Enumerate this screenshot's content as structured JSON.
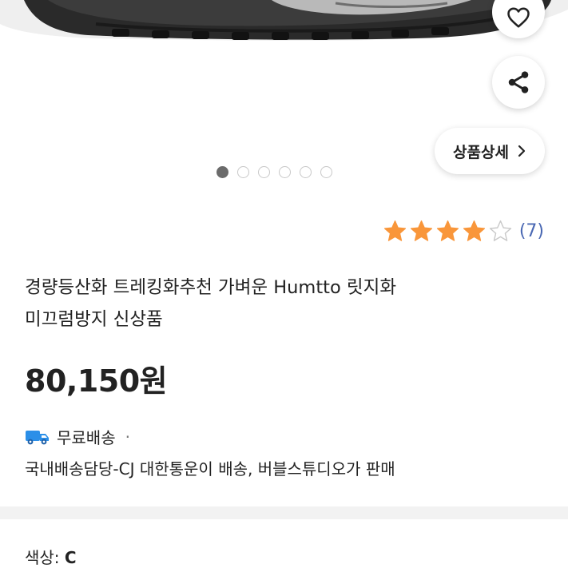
{
  "product": {
    "image_dots": {
      "count": 6,
      "active_index": 0
    },
    "actions": {
      "favorite_icon": "heart-outline-icon",
      "share_icon": "share-icon",
      "detail_label": "상품상세",
      "detail_chevron": "›"
    },
    "rating": {
      "stars": 4,
      "max": 5,
      "count_label": "(7)",
      "star_color": "#f9963a"
    },
    "title_line1": "경량등산화 트레킹화추천 가벼운 Humtto 릿지화",
    "title_line2": "미끄럼방지 신상품",
    "price": "80,150원",
    "shipping": {
      "icon": "truck-icon",
      "label": "무료배송",
      "separator": "·",
      "description": "국내배송담당-CJ 대한통운이 배송, 버블스튜디오가 판매"
    },
    "option": {
      "label": "색상: ",
      "value": "C"
    }
  }
}
